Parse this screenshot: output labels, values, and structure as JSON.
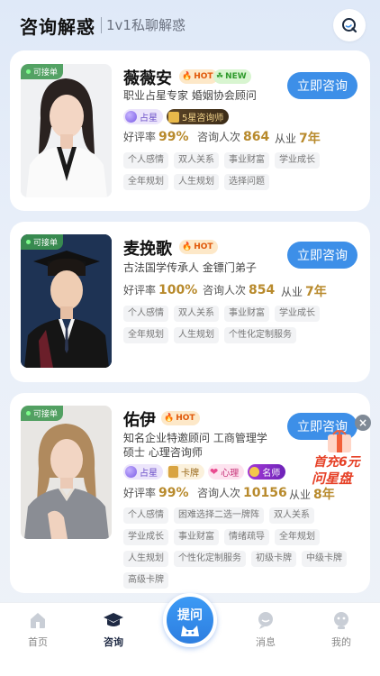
{
  "header": {
    "title": "咨询解惑",
    "subtitle": "1v1私聊解惑"
  },
  "advisors": [
    {
      "status": "可接单",
      "name": "薇薇安",
      "badges": [
        "HOT",
        "NEW"
      ],
      "consult_label": "立即咨询",
      "desc": "职业占星专家  婚姻协会顾问",
      "certs": [
        "占星",
        "5星咨询师"
      ],
      "rating_label": "好评率",
      "rating": "99%",
      "count_label": "咨询人次",
      "count": "864",
      "years_label": "从业",
      "years": "7年",
      "tags": [
        "个人感情",
        "双人关系",
        "事业财富",
        "学业成长",
        "全年规划",
        "人生规划",
        "选择问题"
      ]
    },
    {
      "status": "可接单",
      "name": "麦挽歌",
      "badges": [
        "HOT"
      ],
      "consult_label": "立即咨询",
      "desc": "古法国学传承人  金镖门弟子",
      "certs": [],
      "rating_label": "好评率",
      "rating": "100%",
      "count_label": "咨询人次",
      "count": "854",
      "years_label": "从业",
      "years": "7年",
      "tags": [
        "个人感情",
        "双人关系",
        "事业财富",
        "学业成长",
        "全年规划",
        "人生规划",
        "个性化定制服务"
      ]
    },
    {
      "status": "可接单",
      "name": "佑伊",
      "badges": [
        "HOT"
      ],
      "consult_label": "立即咨询",
      "desc": "知名企业特邀顾问 工商管理学硕士 心理咨询师",
      "certs": [
        "占星",
        "卡牌",
        "心理",
        "名师"
      ],
      "rating_label": "好评率",
      "rating": "99%",
      "count_label": "咨询人次",
      "count": "10156",
      "years_label": "从业",
      "years": "8年",
      "tags": [
        "个人感情",
        "困难选择二选一牌阵",
        "双人关系",
        "学业成长",
        "事业财富",
        "情绪疏导",
        "全年规划",
        "人生规划",
        "个性化定制服务",
        "初级卡牌",
        "中级卡牌",
        "高级卡牌"
      ]
    }
  ],
  "promo": {
    "line1": "首充6元",
    "line2": "问星盘",
    "close": "×"
  },
  "nav": {
    "home": "首页",
    "consult": "咨询",
    "ask": "提问",
    "message": "消息",
    "mine": "我的"
  },
  "colors": {
    "accent": "#3d8fe8",
    "gold": "#b88a2c",
    "hot": "#e0580a"
  }
}
